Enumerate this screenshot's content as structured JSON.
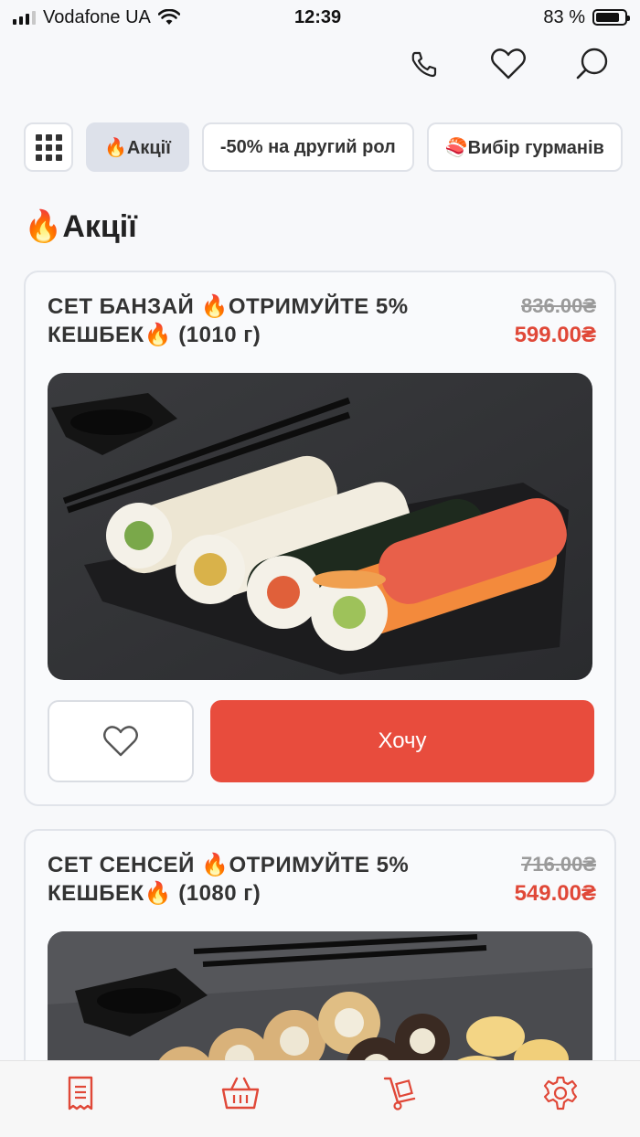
{
  "status_bar": {
    "carrier": "Vodafone UA",
    "time": "12:39",
    "battery_percent": "83 %",
    "battery_level": 0.83
  },
  "header": {
    "icons": [
      "phone-icon",
      "heart-icon",
      "search-icon"
    ]
  },
  "categories": {
    "items": [
      {
        "label": "🔥Акції",
        "active": true
      },
      {
        "label": "-50% на другий рол",
        "active": false
      },
      {
        "label": "🍣Вибір гурманів",
        "active": false
      }
    ]
  },
  "section": {
    "title": "🔥Акції"
  },
  "products": [
    {
      "name": "СЕТ БАНЗАЙ 🔥ОТРИМУЙТЕ 5% КЕШБЕК🔥 (1010 г)",
      "old_price": "836.00₴",
      "new_price": "599.00₴",
      "button_label": "Хочу"
    },
    {
      "name": "СЕТ СЕНСЕЙ 🔥ОТРИМУЙТЕ 5% КЕШБЕК🔥 (1080 г)",
      "old_price": "716.00₴",
      "new_price": "549.00₴"
    }
  ],
  "bottom_nav": {
    "items": [
      "menu-icon",
      "basket-icon",
      "delivery-cart-icon",
      "settings-icon"
    ]
  },
  "colors": {
    "accent": "#e84c3d",
    "price_red": "#e04838",
    "chip_active": "#dde1ea"
  }
}
